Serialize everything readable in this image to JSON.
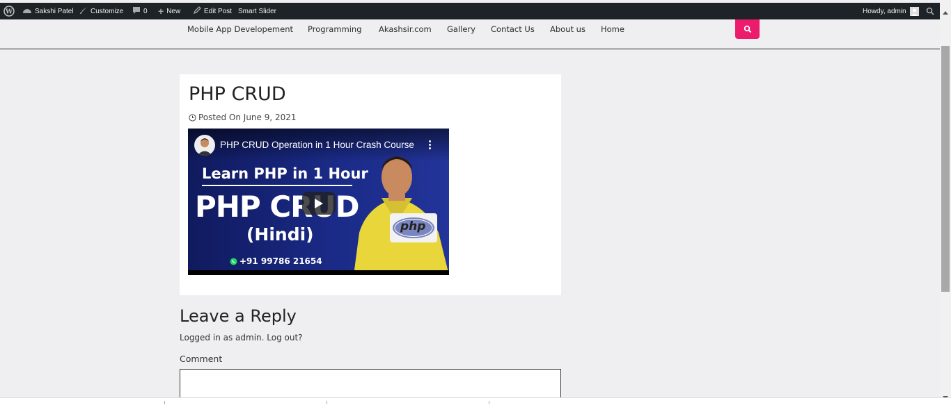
{
  "admin_bar": {
    "site_name": "Sakshi Patel",
    "customize": "Customize",
    "comments_count": "0",
    "new": "New",
    "edit_post": "Edit Post",
    "smart_slider": "Smart Slider",
    "howdy": "Howdy, admin"
  },
  "nav": {
    "items": [
      "Mobile App Developement",
      "Programming",
      "Akashsir.com",
      "Gallery",
      "Contact Us",
      "About us",
      "Home"
    ]
  },
  "post": {
    "title": "PHP CRUD",
    "meta": "Posted On June 9, 2021"
  },
  "video": {
    "title": "PHP CRUD Operation in 1 Hour Crash Course",
    "headline": "Learn PHP in 1 Hour",
    "big_text": "PHP CRUD",
    "language": "(Hindi)",
    "phone": "+91 99786 21654",
    "logo": "php"
  },
  "reply": {
    "title": "Leave a Reply",
    "logged_in": "Logged in as admin. Log out?",
    "comment_label": "Comment"
  },
  "colors": {
    "accent": "#ec1b6c",
    "admin_bar": "#1d2327",
    "page_bg": "#efeff1"
  }
}
